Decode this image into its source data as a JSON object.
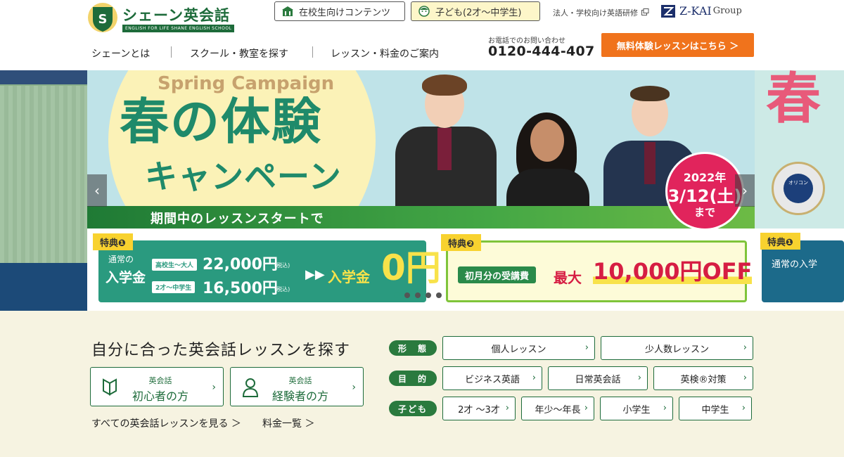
{
  "header": {
    "logo": {
      "title": "シェーン英会話",
      "tagline": "ENGLISH FOR LIFE  SHANE ENGLISH SCHOOL"
    },
    "top_links": {
      "students": "在校生向けコンテンツ",
      "kids": "子ども(2才〜中学生)",
      "corporate": "法人・学校向け英語研修",
      "group": "Z-KAI",
      "group_suffix": "Group"
    },
    "nav": [
      "シェーンとは",
      "スクール・教室を探す",
      "レッスン・料金のご案内"
    ],
    "phone": {
      "caption": "お電話でのお問い合わせ",
      "number": "0120-444-407"
    },
    "cta": "無料体験レッスンはこちら ＞"
  },
  "hero": {
    "campaign_en": "Spring Campaign",
    "headline_1": "春の体験",
    "headline_2": "キャンペーン",
    "bar_text": "期間中のレッスンスタートで",
    "date_badge": {
      "year": "2022年",
      "date": "3/12(土)",
      "until": "まで"
    },
    "benefit1": {
      "label": "特典❶",
      "line1": "通常の",
      "line2": "入学金",
      "tiers": [
        {
          "tag": "高校生〜大人",
          "price": "22,000円",
          "tax": "(税込)"
        },
        {
          "tag": "2才〜中学生",
          "price": "16,500円",
          "tax": "(税込)"
        }
      ],
      "arrows": "▶▶",
      "result_label": "入学金",
      "result_value": "0円"
    },
    "benefit2": {
      "label": "特典❷",
      "tag": "初月分の受講費",
      "max": "最大",
      "amount": "10,000円OFF"
    },
    "side_right": {
      "big": "春",
      "benefit_label": "特典❶",
      "text": "通常の入学",
      "medal": "オリコン"
    },
    "carousel": {
      "prev": "‹",
      "next": "›",
      "slides": 5,
      "active": 0
    }
  },
  "finder": {
    "title": "自分に合った英会話レッスンを探す",
    "levels": [
      {
        "category": "英会話",
        "name": "初心者の方",
        "icon": "beginner-leaf-icon"
      },
      {
        "category": "英会話",
        "name": "経験者の方",
        "icon": "person-icon"
      }
    ],
    "links": [
      "すべての英会話レッスンを見る ＞",
      "料金一覧 ＞"
    ],
    "rows": [
      {
        "tag": "形　態",
        "options": [
          "個人レッスン",
          "少人数レッスン"
        ]
      },
      {
        "tag": "目　的",
        "options": [
          "ビジネス英語",
          "日常英会話",
          "英検®対策"
        ]
      },
      {
        "tag": "子ども",
        "options": [
          "2才 〜3才",
          "年少〜年長",
          "小学生",
          "中学生"
        ]
      }
    ],
    "chevron": "›"
  },
  "colors": {
    "brand_green": "#1d6b3a",
    "cta_orange": "#f0731c",
    "accent_red": "#e1245c",
    "section_bg": "#f6f3e1"
  }
}
